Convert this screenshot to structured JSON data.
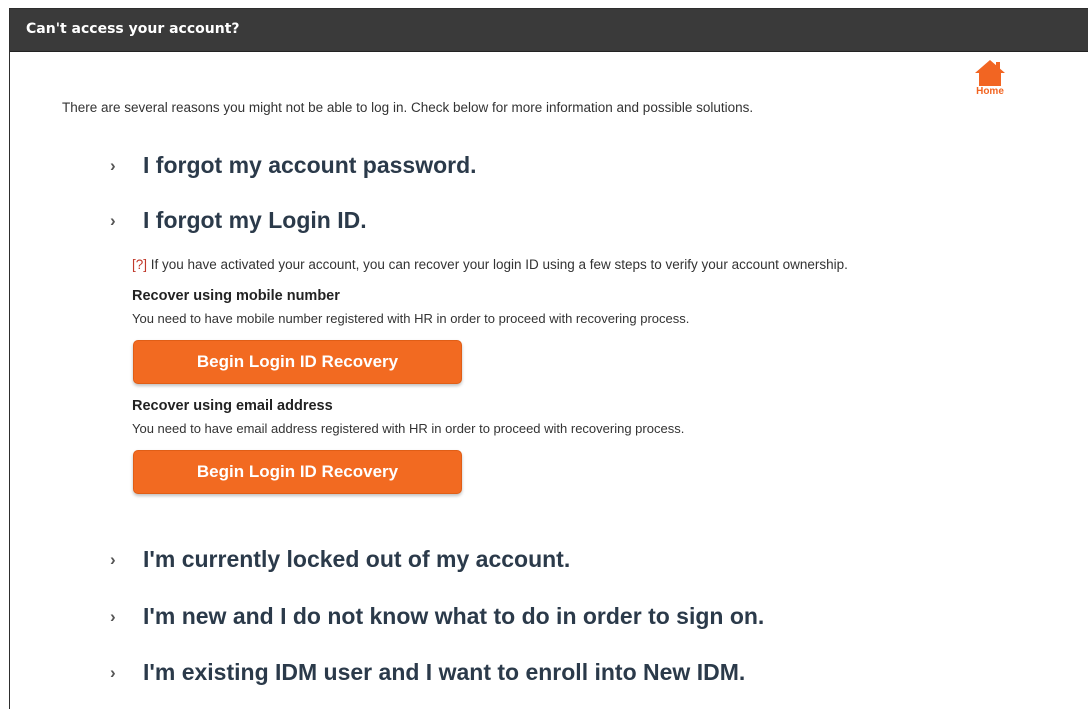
{
  "window": {
    "title": "Can't access your account?"
  },
  "home": {
    "label": "Home",
    "icon": "home-icon",
    "color": "#f26522"
  },
  "intro": "There are several reasons you might not be able to log in. Check below for more information and possible solutions.",
  "sections": [
    {
      "label": "I forgot my account password."
    },
    {
      "label": "I forgot my Login ID."
    },
    {
      "label": "I'm currently locked out of my account."
    },
    {
      "label": "I'm new and I do not know what to do in order to sign on."
    },
    {
      "label": "I'm existing IDM user and I want to enroll into New IDM."
    }
  ],
  "login_id": {
    "help_marker": "[?]",
    "help_text": " If you have activated your account, you can recover your login ID using a few steps to verify your account ownership.",
    "options": [
      {
        "title": "Recover using mobile number",
        "description": "You need to have mobile number registered with HR in order to proceed with recovering process.",
        "button_label": "Begin Login ID Recovery"
      },
      {
        "title": "Recover using email address",
        "description": "You need to have email address registered with HR in order to proceed with recovering process.",
        "button_label": "Begin Login ID Recovery"
      }
    ]
  },
  "colors": {
    "accent": "#f26a21",
    "titlebar": "#3a3a3a",
    "heading": "#2b3a4a"
  }
}
